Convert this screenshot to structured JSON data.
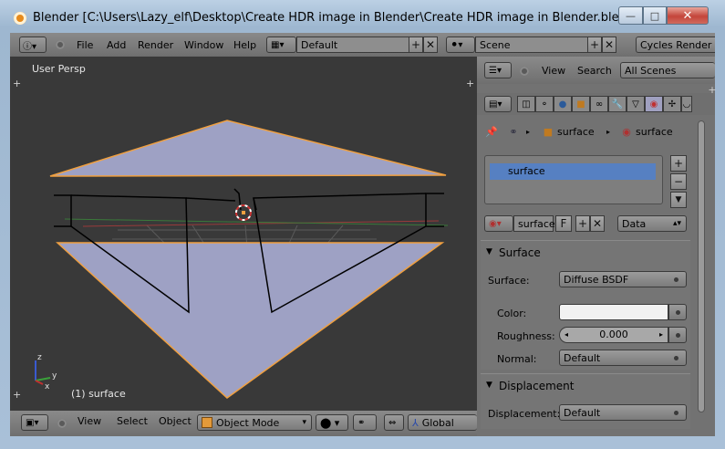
{
  "window": {
    "title": "Blender [C:\\Users\\Lazy_elf\\Desktop\\Create HDR image in Blender\\Create HDR image in Blender.blend]",
    "minimize": "—",
    "maximize": "□",
    "close": "✕"
  },
  "top_header": {
    "menus": [
      "File",
      "Add",
      "Render",
      "Window",
      "Help"
    ],
    "screen": "Default",
    "scene": "Scene",
    "engine": "Cycles Render"
  },
  "outliner_header": {
    "view": "View",
    "search": "Search",
    "scenes": "All Scenes"
  },
  "viewport": {
    "label": "User Persp",
    "object_label": "(1) surface",
    "axis_x": "x",
    "axis_y": "y",
    "axis_z": "z"
  },
  "bottom_header": {
    "menus": [
      "View",
      "Select",
      "Object"
    ],
    "mode": "Object Mode",
    "orientation": "Global"
  },
  "properties": {
    "breadcrumb_1": "surface",
    "breadcrumb_2": "surface",
    "slot": "surface",
    "material_name": "surface",
    "fake_user": "F",
    "link": "Data",
    "surface_panel": {
      "title": "Surface",
      "surface_label": "Surface:",
      "surface_value": "Diffuse BSDF",
      "color_label": "Color:",
      "roughness_label": "Roughness:",
      "roughness_value": "0.000",
      "normal_label": "Normal:",
      "normal_value": "Default"
    },
    "displacement_panel": {
      "title": "Displacement",
      "label": "Displacement:",
      "value": "Default"
    }
  },
  "colors": {
    "viewport_bg": "#393939",
    "plane_fill": "#9ea1c4",
    "selection_outline": "#f0a040",
    "slot_highlight": "#5680c2"
  }
}
